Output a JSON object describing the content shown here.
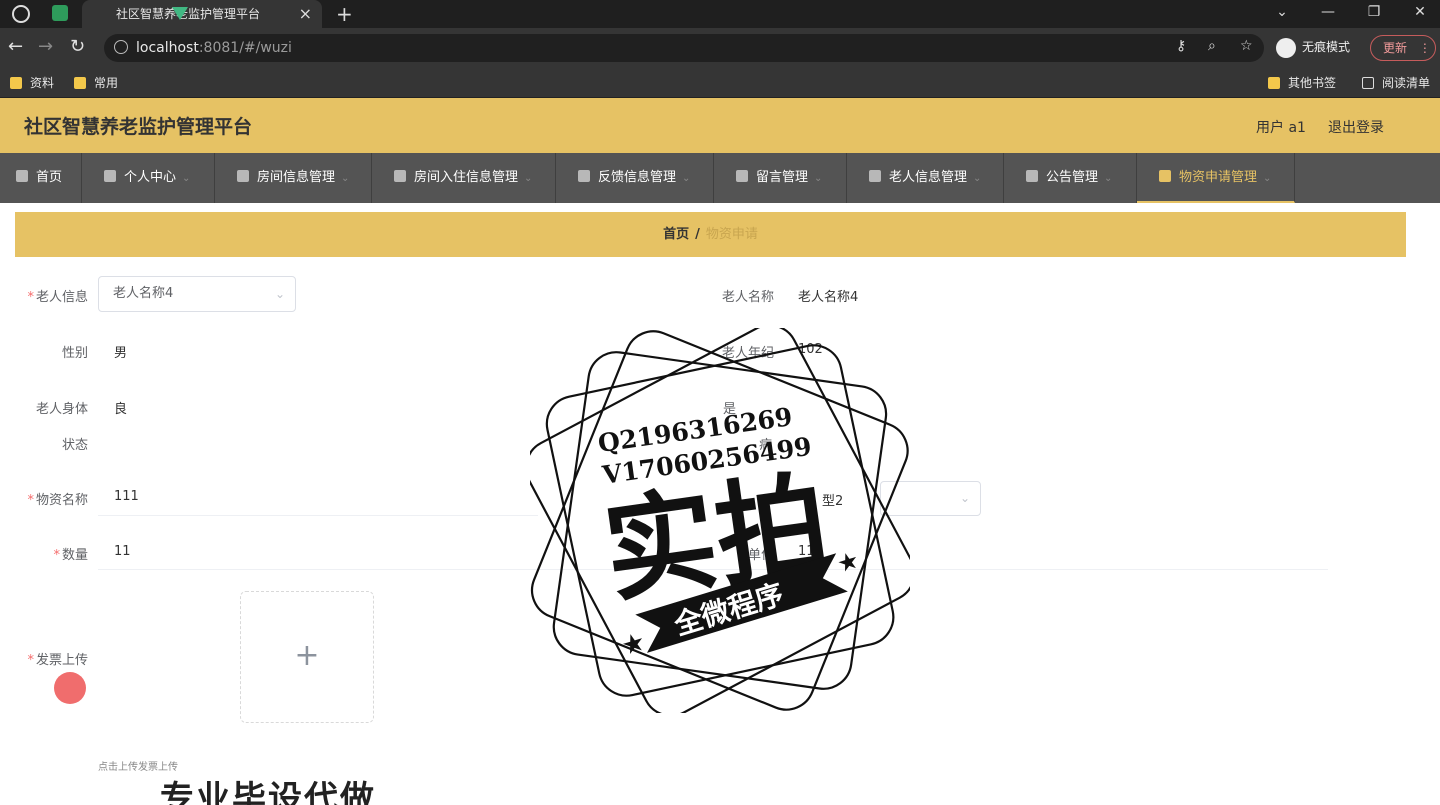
{
  "browser": {
    "tab_title": "社区智慧养老监护管理平台",
    "url_host": "localhost",
    "url_rest": ":8081/#/wuzi",
    "incognito_label": "无痕模式",
    "update_label": "更新",
    "bookmarks": [
      "资料",
      "常用"
    ],
    "bookmarks_right": [
      "其他书签",
      "阅读清单"
    ]
  },
  "header": {
    "brand": "社区智慧养老监护管理平台",
    "user": "用户 a1",
    "logout": "退出登录"
  },
  "menu": [
    {
      "label": "首页"
    },
    {
      "label": "个人中心"
    },
    {
      "label": "房间信息管理"
    },
    {
      "label": "房间入住信息管理"
    },
    {
      "label": "反馈信息管理"
    },
    {
      "label": "留言管理"
    },
    {
      "label": "老人信息管理"
    },
    {
      "label": "公告管理"
    },
    {
      "label": "物资申请管理"
    }
  ],
  "breadcrumb": {
    "home": "首页",
    "sep": "/",
    "current": "物资申请"
  },
  "form": {
    "elder_info_label": "老人信息",
    "elder_info_value": "老人名称4",
    "elder_name_label": "老人名称",
    "elder_name_value": "老人名称4",
    "gender_label": "性别",
    "gender_value": "男",
    "age_label": "老人年纪",
    "age_value": "102",
    "health_label_1": "老人身体",
    "health_label_2": "状态",
    "health_value": "良",
    "is_label": "是",
    "disease_label": "病",
    "material_label": "物资名称",
    "material_value": "111",
    "type_value": "型2",
    "qty_label": "数量",
    "qty_value": "11",
    "unit_label": "单位",
    "unit_value": "11",
    "invoice_label": "发票上传",
    "upload_plus": "+",
    "upload_hint": "点击上传发票上传"
  },
  "watermark": {
    "line1": "Q2196316269",
    "line2": "V17060256499",
    "big": "实拍",
    "ribbon": "全微程序",
    "bottom": "专业毕设代做"
  }
}
